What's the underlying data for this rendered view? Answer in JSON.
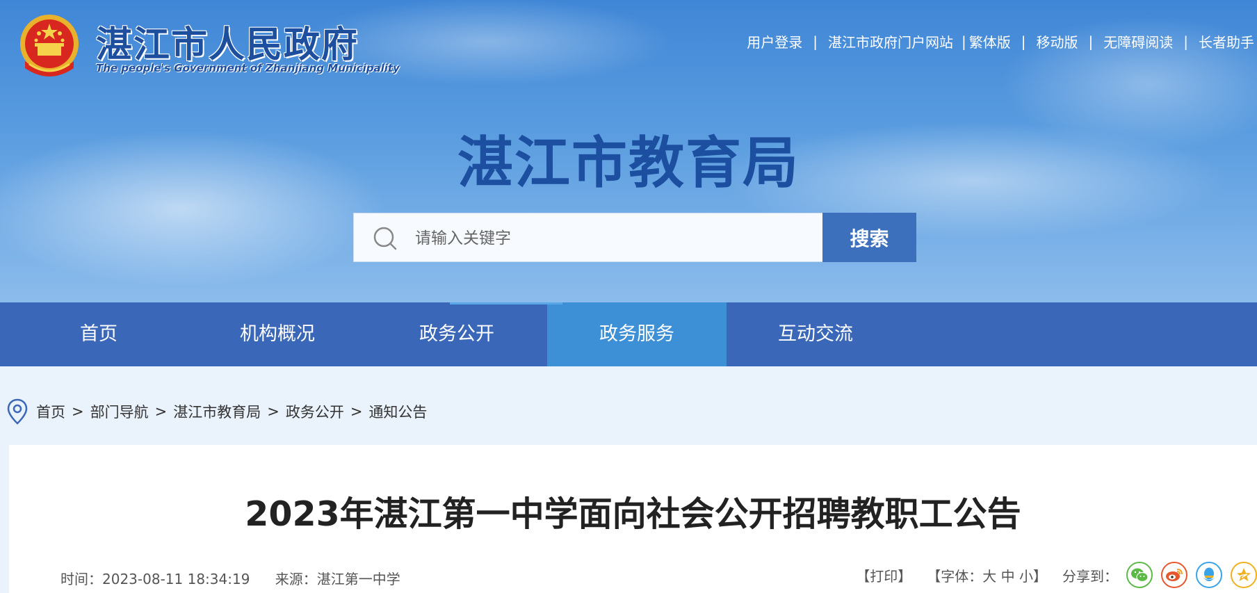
{
  "header": {
    "site_name_cn": "湛江市人民政府",
    "site_name_en": "The people's Government of Zhanjiang Municipality",
    "links": [
      "用户登录",
      "湛江市政府门户网站",
      "繁体版",
      "移动版",
      "无障碍阅读",
      "长者助手"
    ],
    "separators": [
      "|",
      "|",
      "|",
      "|",
      "|"
    ]
  },
  "department_title": "湛江市教育局",
  "search": {
    "placeholder": "请输入关键字",
    "button_label": "搜索"
  },
  "nav": {
    "items": [
      "首页",
      "机构概况",
      "政务公开",
      "政务服务",
      "互动交流"
    ],
    "active_index": 3
  },
  "breadcrumb": {
    "items": [
      "首页",
      "部门导航",
      "湛江市教育局",
      "政务公开",
      "通知公告"
    ],
    "separator": ">"
  },
  "article": {
    "title": "2023年湛江第一中学面向社会公开招聘教职工公告",
    "time_label": "时间：",
    "time_value": "2023-08-11 18:34:19",
    "source_label": "来源：",
    "source_value": "湛江第一中学",
    "print_label": "【打印】",
    "font_open": "【字体：",
    "font_large": "大",
    "font_medium": "中",
    "font_small": "小",
    "font_close": "】",
    "share_label": "分享到："
  },
  "colors": {
    "nav_bg": "#3a67b7",
    "nav_active": "#3d8fd6",
    "title_blue": "#1c4fa0",
    "wechat": "#5bb946",
    "weibo": "#e6572f",
    "qq": "#3aa3e8",
    "qzone": "#f0b020"
  },
  "icons": [
    "national-emblem",
    "search-icon",
    "location-pin-icon",
    "wechat-icon",
    "weibo-icon",
    "qq-icon",
    "qzone-icon"
  ]
}
